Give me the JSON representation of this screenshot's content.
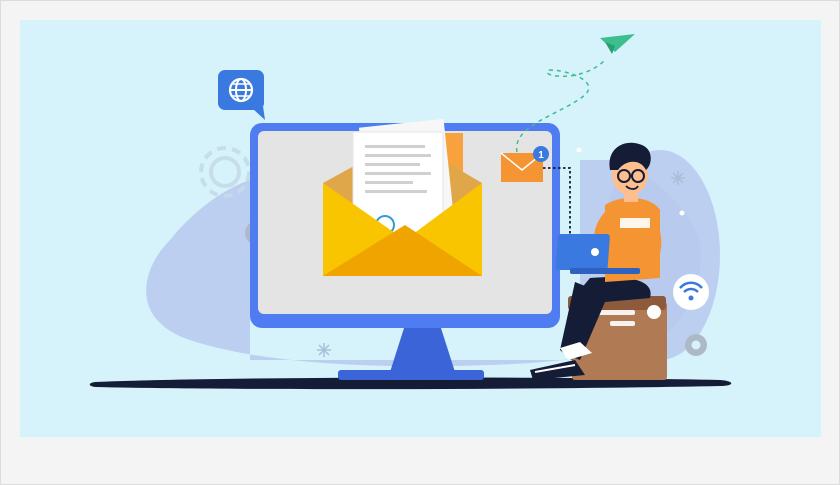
{
  "illustration": {
    "subject": "email-marketing-illustration",
    "notification_count": "1",
    "colors": {
      "background": "#d6f2fb",
      "monitor": "#4f7cf0",
      "screen": "#e4e4e4",
      "envelope": "#f9c400",
      "envelope_dark": "#f0a400",
      "cloud_blob": "#b9c9ef",
      "shirt": "#f59433",
      "laptop": "#3a79e0",
      "crate": "#b07a55",
      "plane": "#3bbf8f"
    }
  }
}
